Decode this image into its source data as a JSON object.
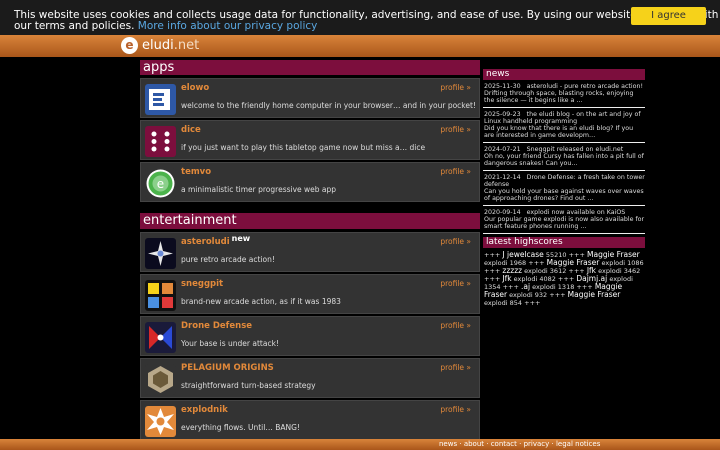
{
  "cookie": {
    "text": "This website uses cookies and collects usage data for functionality, advertising, and ease of use. By using our website you agree with our terms and policies.",
    "link": "More info about our privacy policy",
    "button": "I agree"
  },
  "logo": {
    "letter": "e",
    "name": "eludi",
    "suffix": ".net"
  },
  "apps": {
    "header": "apps",
    "items": [
      {
        "title": "elowo",
        "desc": "welcome to the friendly home computer in your browser… and in your pocket!",
        "profile": "profile »"
      },
      {
        "title": "dice",
        "desc": "if you just want to play this tabletop game now but miss a… dice",
        "profile": "profile »"
      },
      {
        "title": "temvo",
        "desc": "a minimalistic timer progressive web app",
        "profile": "profile »"
      }
    ]
  },
  "entertainment": {
    "header": "entertainment",
    "items": [
      {
        "title": "asteroludi",
        "badge": "new",
        "desc": "pure retro arcade action!",
        "profile": "profile »"
      },
      {
        "title": "sneggpit",
        "desc": "brand-new arcade action, as if it was 1983",
        "profile": "profile »"
      },
      {
        "title": "Drone Defense",
        "desc": "Your base is under attack!",
        "profile": "profile »"
      },
      {
        "title": "PELAGIUM ORIGINS",
        "desc": "straightforward turn-based strategy",
        "profile": "profile »"
      },
      {
        "title": "explodnik",
        "desc": "everything flows. Until… BANG!",
        "profile": "profile »"
      }
    ]
  },
  "news": {
    "header": "news",
    "items": [
      {
        "date": "2025-11-30",
        "title": "asteroludi - pure retro arcade action!",
        "body": "Drifting through space, blasting rocks, enjoying the silence — it begins like a …"
      },
      {
        "date": "2025-09-23",
        "title": "the eludi blog - on the art and joy of Linux handheld programming",
        "body": "Did you know that there is an eludi blog? If you are interested in game developm…"
      },
      {
        "date": "2024-07-21",
        "title": "Sneggpit released on eludi.net",
        "body": "Oh no, your friend Cursy has fallen into a pit full of dangerous snakes! Can you…"
      },
      {
        "date": "2021-12-14",
        "title": "Drone Defense: a fresh take on tower defense",
        "body": "Can you hold your base against waves over waves of approaching drones? Find out …"
      },
      {
        "date": "2020-09-14",
        "title": "explodi now available on KaiOS",
        "body": "Our popular game explodi is now also available for smart feature phones running …"
      }
    ]
  },
  "scores": {
    "header": "latest highscores",
    "entries": [
      {
        "name": "J jewelcase",
        "game": "",
        "score": "55210"
      },
      {
        "name": "Maggie Fraser",
        "game": "explodi",
        "score": "1968"
      },
      {
        "name": "Maggie Fraser",
        "game": "explodi",
        "score": "1086"
      },
      {
        "name": "zzzzz",
        "game": "explodi",
        "score": "3612"
      },
      {
        "name": "Jfk",
        "game": "explodi",
        "score": "3462"
      },
      {
        "name": "Jfk",
        "game": "explodi",
        "score": "4082"
      },
      {
        "name": "Dajmj.aj",
        "game": "explodi",
        "score": "1354"
      },
      {
        "name": ".aj",
        "game": "explodi",
        "score": "1318"
      },
      {
        "name": "Maggie Fraser",
        "game": "explodi",
        "score": "932"
      },
      {
        "name": "Maggie Fraser",
        "game": "explodi",
        "score": "854"
      }
    ]
  },
  "footer": {
    "links": [
      "news",
      "about",
      "contact",
      "privacy",
      "legal notices"
    ],
    "separator": " · "
  }
}
